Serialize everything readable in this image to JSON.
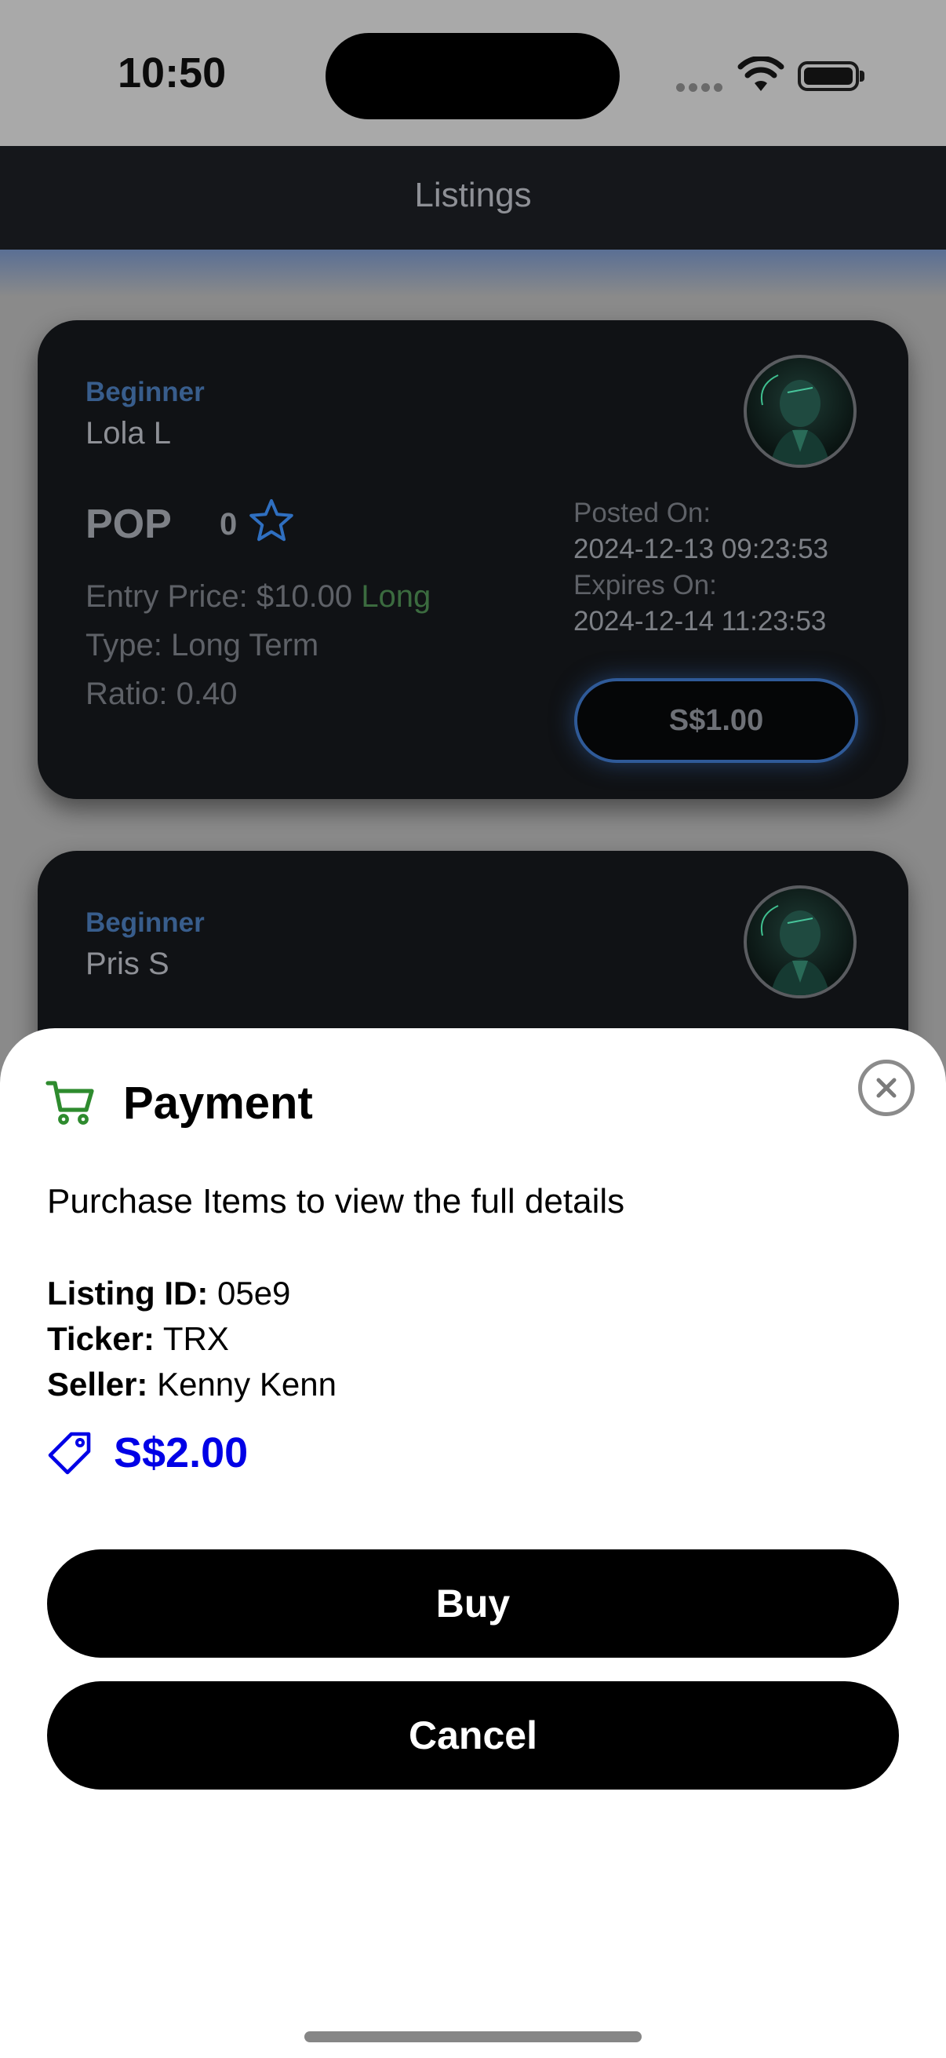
{
  "status": {
    "time": "10:50"
  },
  "nav": {
    "title": "Listings"
  },
  "listings": [
    {
      "level": "Beginner",
      "name": "Lola L",
      "ticker": "POP",
      "rating": "0",
      "entry_label": "Entry Price: $10.00",
      "direction": "Long",
      "type": "Type: Long Term",
      "ratio": "Ratio: 0.40",
      "posted_label": "Posted On:",
      "posted_value": "2024-12-13 09:23:53",
      "expires_label": "Expires On:",
      "expires_value": "2024-12-14 11:23:53",
      "price": "S$1.00"
    },
    {
      "level": "Beginner",
      "name": "Pris S"
    }
  ],
  "payment": {
    "title": "Payment",
    "subtitle": "Purchase Items to view the full details",
    "listing_id_label": "Listing ID:",
    "listing_id": "05e9",
    "ticker_label": "Ticker:",
    "ticker": "TRX",
    "seller_label": "Seller:",
    "seller": "Kenny Kenn",
    "amount": "S$2.00",
    "buy_label": "Buy",
    "cancel_label": "Cancel"
  },
  "colors": {
    "accent_blue": "#0000e6",
    "cart_green": "#2e8b2e",
    "long_green": "#3b6b3f",
    "level_blue": "#385d8c"
  }
}
